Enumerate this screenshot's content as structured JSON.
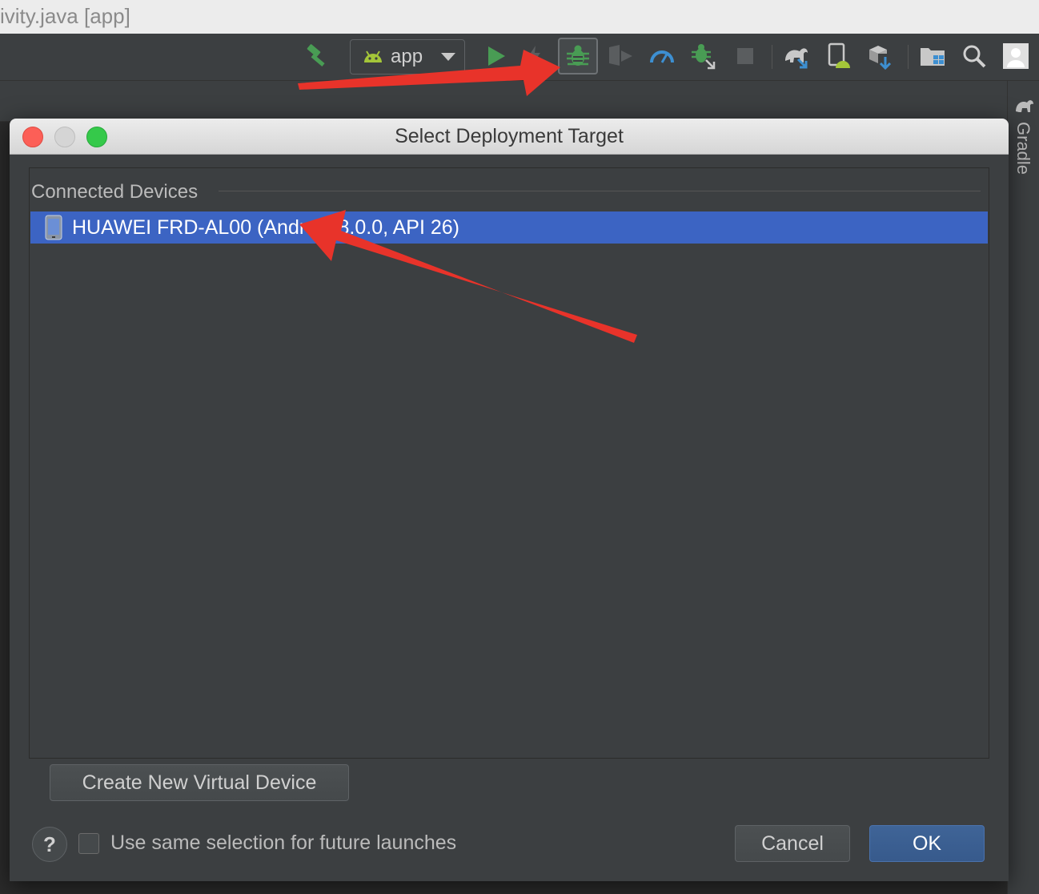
{
  "window": {
    "title": "ivity.java [app]"
  },
  "toolbar": {
    "run_config_label": "app",
    "icons": [
      "hammer-icon",
      "android-icon",
      "chevron-down-icon",
      "run-icon",
      "apply-changes-icon",
      "debug-icon",
      "coverage-icon",
      "profiler-icon",
      "attach-debugger-icon",
      "stop-icon",
      "gradle-sync-icon",
      "avd-manager-icon",
      "sdk-manager-icon",
      "project-structure-icon",
      "search-icon",
      "user-icon"
    ]
  },
  "side_panel": {
    "gradle_label": "Gradle"
  },
  "dialog": {
    "title": "Select Deployment Target",
    "section_header": "Connected Devices",
    "devices": [
      {
        "name": "HUAWEI FRD-AL00 (Android 8.0.0, API 26)",
        "selected": true,
        "icon": "phone-icon"
      }
    ],
    "create_button": "Create New Virtual Device",
    "help_label": "?",
    "checkbox_label": "Use same selection for future launches",
    "checkbox_checked": false,
    "cancel_button": "Cancel",
    "ok_button": "OK"
  },
  "colors": {
    "selection": "#3c64c3",
    "ok_button": "#375a8c",
    "annotation_arrow": "#e8332a",
    "android_green": "#a4c639",
    "run_green": "#499c54"
  }
}
